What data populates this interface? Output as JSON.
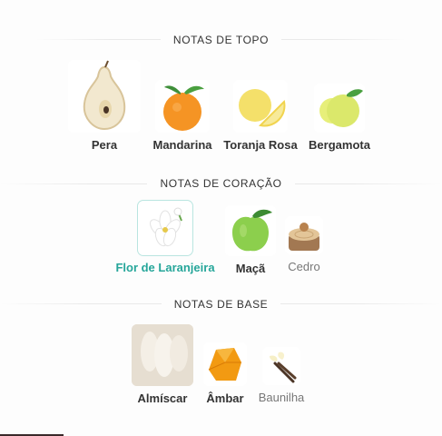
{
  "sections": [
    {
      "title": "NOTAS DE TOPO",
      "notes": [
        {
          "label": "Pera",
          "icon": "pear-icon"
        },
        {
          "label": "Mandarina",
          "icon": "mandarin-icon"
        },
        {
          "label": "Toranja Rosa",
          "icon": "grapefruit-icon"
        },
        {
          "label": "Bergamota",
          "icon": "bergamot-icon"
        }
      ]
    },
    {
      "title": "NOTAS DE CORAÇÃO",
      "notes": [
        {
          "label": "Flor de Laranjeira",
          "icon": "orange-blossom-icon",
          "state": "selected"
        },
        {
          "label": "Maçã",
          "icon": "apple-icon"
        },
        {
          "label": "Cedro",
          "icon": "cedar-icon"
        }
      ]
    },
    {
      "title": "NOTAS DE BASE",
      "notes": [
        {
          "label": "Almíscar",
          "icon": "musk-icon"
        },
        {
          "label": "Âmbar",
          "icon": "amber-icon"
        },
        {
          "label": "Baunilha",
          "icon": "vanilla-icon"
        }
      ]
    }
  ],
  "colors": {
    "accent": "#26a69a",
    "text": "#333333",
    "muted": "#777777"
  }
}
